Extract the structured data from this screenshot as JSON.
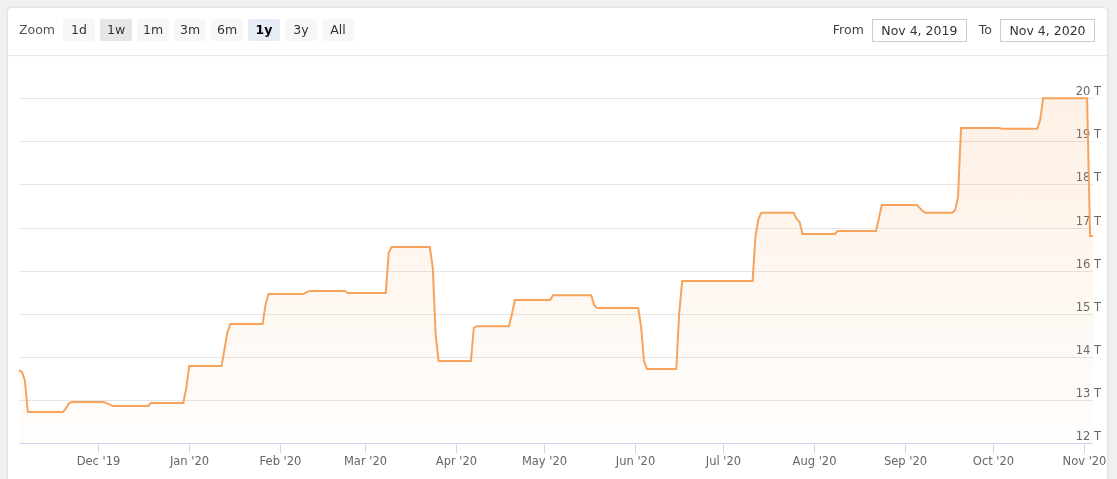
{
  "range_selector": {
    "label": "Zoom",
    "buttons": [
      {
        "label": "1d",
        "selected": false,
        "hovered": false
      },
      {
        "label": "1w",
        "selected": false,
        "hovered": true
      },
      {
        "label": "1m",
        "selected": false,
        "hovered": false
      },
      {
        "label": "3m",
        "selected": false,
        "hovered": false
      },
      {
        "label": "6m",
        "selected": false,
        "hovered": false
      },
      {
        "label": "1y",
        "selected": true,
        "hovered": false
      },
      {
        "label": "3y",
        "selected": false,
        "hovered": false
      },
      {
        "label": "All",
        "selected": false,
        "hovered": false
      }
    ]
  },
  "date_range": {
    "from_label": "From",
    "from_value": "Nov 4, 2019",
    "to_label": "To",
    "to_value": "Nov 4, 2020"
  },
  "chart_data": {
    "type": "area",
    "grid": true,
    "ylim": [
      12,
      21
    ],
    "yticks": [
      {
        "value": 12,
        "label": "12 T"
      },
      {
        "value": 13,
        "label": "13 T"
      },
      {
        "value": 14,
        "label": "14 T"
      },
      {
        "value": 15,
        "label": "15 T"
      },
      {
        "value": 16,
        "label": "16 T"
      },
      {
        "value": 17,
        "label": "17 T"
      },
      {
        "value": 18,
        "label": "18 T"
      },
      {
        "value": 19,
        "label": "19 T"
      },
      {
        "value": 20,
        "label": "20 T"
      }
    ],
    "categories": [
      null,
      null,
      null,
      null,
      null,
      null,
      null,
      null,
      null,
      null,
      null,
      null,
      null,
      null,
      null,
      null,
      null,
      null,
      null,
      null,
      null,
      null,
      null,
      null,
      null,
      null,
      null,
      "Dec '19",
      null,
      null,
      null,
      null,
      null,
      null,
      null,
      null,
      null,
      null,
      null,
      null,
      null,
      null,
      null,
      null,
      null,
      null,
      null,
      null,
      null,
      null,
      null,
      null,
      null,
      null,
      null,
      null,
      null,
      null,
      "Jan '20",
      null,
      null,
      null,
      null,
      null,
      null,
      null,
      null,
      null,
      null,
      null,
      null,
      null,
      null,
      null,
      null,
      null,
      null,
      null,
      null,
      null,
      null,
      null,
      null,
      null,
      null,
      null,
      null,
      null,
      null,
      "Feb '20",
      null,
      null,
      null,
      null,
      null,
      null,
      null,
      null,
      null,
      null,
      null,
      null,
      null,
      null,
      null,
      null,
      null,
      null,
      null,
      null,
      null,
      null,
      null,
      null,
      null,
      null,
      null,
      null,
      "Mar '20",
      null,
      null,
      null,
      null,
      null,
      null,
      null,
      null,
      null,
      null,
      null,
      null,
      null,
      null,
      null,
      null,
      null,
      null,
      null,
      null,
      null,
      null,
      null,
      null,
      null,
      null,
      null,
      null,
      null,
      null,
      "Apr '20",
      null,
      null,
      null,
      null,
      null,
      null,
      null,
      null,
      null,
      null,
      null,
      null,
      null,
      null,
      null,
      null,
      null,
      null,
      null,
      null,
      null,
      null,
      null,
      null,
      null,
      null,
      null,
      null,
      null,
      "May '20",
      null,
      null,
      null,
      null,
      null,
      null,
      null,
      null,
      null,
      null,
      null,
      null,
      null,
      null,
      null,
      null,
      null,
      null,
      null,
      null,
      null,
      null,
      null,
      null,
      null,
      null,
      null,
      null,
      null,
      null,
      "Jun '20",
      null,
      null,
      null,
      null,
      null,
      null,
      null,
      null,
      null,
      null,
      null,
      null,
      null,
      null,
      null,
      null,
      null,
      null,
      null,
      null,
      null,
      null,
      null,
      null,
      null,
      null,
      null,
      null,
      null,
      "Jul '20",
      null,
      null,
      null,
      null,
      null,
      null,
      null,
      null,
      null,
      null,
      null,
      null,
      null,
      null,
      null,
      null,
      null,
      null,
      null,
      null,
      null,
      null,
      null,
      null,
      null,
      null,
      null,
      null,
      null,
      null,
      "Aug '20",
      null,
      null,
      null,
      null,
      null,
      null,
      null,
      null,
      null,
      null,
      null,
      null,
      null,
      null,
      null,
      null,
      null,
      null,
      null,
      null,
      null,
      null,
      null,
      null,
      null,
      null,
      null,
      null,
      null,
      null,
      "Sep '20",
      null,
      null,
      null,
      null,
      null,
      null,
      null,
      null,
      null,
      null,
      null,
      null,
      null,
      null,
      null,
      null,
      null,
      null,
      null,
      null,
      null,
      null,
      null,
      null,
      null,
      null,
      null,
      null,
      null,
      "Oct '20",
      null,
      null,
      null,
      null,
      null,
      null,
      null,
      null,
      null,
      null,
      null,
      null,
      null,
      null,
      null,
      null,
      null,
      null,
      null,
      null,
      null,
      null,
      null,
      null,
      null,
      null,
      null,
      null,
      null,
      null,
      "Nov '20",
      null,
      null,
      null
    ],
    "series": [
      {
        "color": "#f7a35c",
        "values": [
          13.69,
          13.65,
          13.45,
          12.72,
          12.72,
          12.72,
          12.72,
          12.72,
          12.72,
          12.72,
          12.72,
          12.72,
          12.72,
          12.72,
          12.72,
          12.72,
          12.8,
          12.92,
          12.95,
          12.95,
          12.95,
          12.95,
          12.95,
          12.95,
          12.95,
          12.95,
          12.95,
          12.95,
          12.95,
          12.95,
          12.92,
          12.89,
          12.86,
          12.86,
          12.86,
          12.86,
          12.86,
          12.86,
          12.86,
          12.86,
          12.86,
          12.86,
          12.86,
          12.86,
          12.86,
          12.93,
          12.93,
          12.93,
          12.93,
          12.93,
          12.93,
          12.93,
          12.93,
          12.93,
          12.93,
          12.93,
          12.93,
          13.28,
          13.79,
          13.79,
          13.79,
          13.79,
          13.79,
          13.79,
          13.79,
          13.79,
          13.79,
          13.79,
          13.79,
          13.79,
          14.16,
          14.56,
          14.76,
          14.76,
          14.76,
          14.76,
          14.76,
          14.76,
          14.76,
          14.76,
          14.76,
          14.76,
          14.76,
          14.76,
          15.2,
          15.46,
          15.46,
          15.46,
          15.46,
          15.46,
          15.46,
          15.46,
          15.46,
          15.46,
          15.46,
          15.46,
          15.46,
          15.46,
          15.5,
          15.53,
          15.53,
          15.53,
          15.53,
          15.53,
          15.53,
          15.53,
          15.53,
          15.53,
          15.53,
          15.53,
          15.53,
          15.53,
          15.48,
          15.48,
          15.48,
          15.48,
          15.48,
          15.48,
          15.48,
          15.48,
          15.48,
          15.48,
          15.48,
          15.48,
          15.48,
          15.48,
          16.41,
          16.55,
          16.55,
          16.55,
          16.55,
          16.55,
          16.55,
          16.55,
          16.55,
          16.55,
          16.55,
          16.55,
          16.55,
          16.55,
          16.55,
          16.06,
          14.5,
          13.9,
          13.9,
          13.9,
          13.9,
          13.9,
          13.9,
          13.9,
          13.9,
          13.9,
          13.9,
          13.9,
          13.9,
          14.67,
          14.71,
          14.71,
          14.71,
          14.71,
          14.71,
          14.71,
          14.71,
          14.71,
          14.71,
          14.71,
          14.71,
          14.71,
          15.0,
          15.32,
          15.32,
          15.32,
          15.32,
          15.32,
          15.32,
          15.32,
          15.32,
          15.32,
          15.32,
          15.32,
          15.32,
          15.32,
          15.43,
          15.43,
          15.43,
          15.43,
          15.43,
          15.43,
          15.43,
          15.43,
          15.43,
          15.43,
          15.43,
          15.43,
          15.43,
          15.43,
          15.2,
          15.13,
          15.13,
          15.13,
          15.13,
          15.13,
          15.13,
          15.13,
          15.13,
          15.13,
          15.13,
          15.13,
          15.13,
          15.13,
          15.13,
          15.13,
          14.7,
          13.9,
          13.72,
          13.72,
          13.72,
          13.72,
          13.72,
          13.72,
          13.72,
          13.72,
          13.72,
          13.72,
          13.72,
          15.02,
          15.76,
          15.76,
          15.76,
          15.76,
          15.76,
          15.76,
          15.76,
          15.76,
          15.76,
          15.76,
          15.76,
          15.76,
          15.76,
          15.76,
          15.76,
          15.76,
          15.76,
          15.76,
          15.76,
          15.76,
          15.76,
          15.76,
          15.76,
          15.76,
          15.76,
          16.8,
          17.2,
          17.34,
          17.34,
          17.34,
          17.34,
          17.34,
          17.34,
          17.34,
          17.34,
          17.34,
          17.34,
          17.34,
          17.34,
          17.2,
          17.13,
          16.85,
          16.85,
          16.85,
          16.85,
          16.85,
          16.85,
          16.85,
          16.85,
          16.85,
          16.85,
          16.85,
          16.85,
          16.92,
          16.92,
          16.92,
          16.92,
          16.92,
          16.92,
          16.92,
          16.92,
          16.92,
          16.92,
          16.92,
          16.92,
          16.92,
          16.92,
          17.2,
          17.52,
          17.52,
          17.52,
          17.52,
          17.52,
          17.52,
          17.52,
          17.52,
          17.52,
          17.52,
          17.52,
          17.52,
          17.52,
          17.45,
          17.38,
          17.34,
          17.34,
          17.34,
          17.34,
          17.34,
          17.34,
          17.34,
          17.34,
          17.34,
          17.34,
          17.4,
          17.7,
          19.31,
          19.31,
          19.31,
          19.31,
          19.31,
          19.31,
          19.31,
          19.31,
          19.31,
          19.31,
          19.31,
          19.31,
          19.31,
          19.31,
          19.29,
          19.29,
          19.29,
          19.29,
          19.29,
          19.29,
          19.29,
          19.29,
          19.29,
          19.29,
          19.29,
          19.29,
          19.29,
          19.5,
          20,
          20,
          20,
          20,
          20,
          20,
          20,
          20,
          20,
          20,
          20,
          20,
          20,
          20,
          20,
          20,
          16.8,
          16.8
        ]
      }
    ]
  }
}
